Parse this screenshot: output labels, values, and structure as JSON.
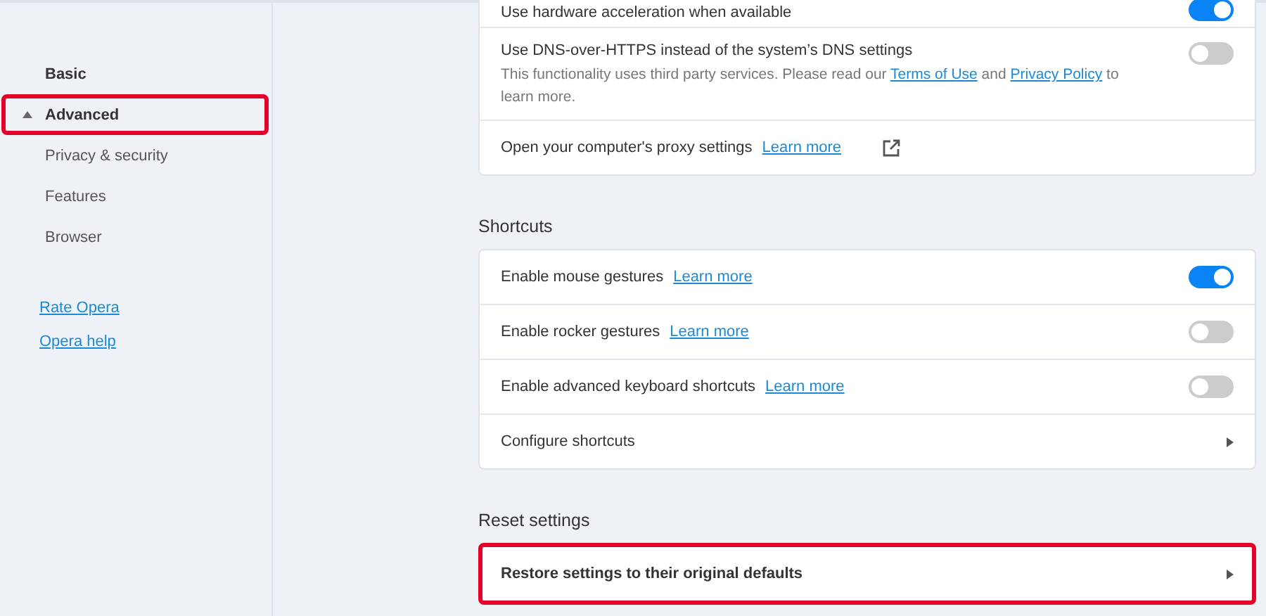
{
  "sidebar": {
    "items": [
      {
        "label": "Basic",
        "kind": "header",
        "expanded": false,
        "highlighted": false
      },
      {
        "label": "Advanced",
        "kind": "header",
        "expanded": true,
        "highlighted": true
      },
      {
        "label": "Privacy & security",
        "kind": "item",
        "highlighted": false
      },
      {
        "label": "Features",
        "kind": "item",
        "highlighted": false
      },
      {
        "label": "Browser",
        "kind": "item",
        "highlighted": false
      }
    ],
    "links": [
      "Rate Opera",
      "Opera help"
    ]
  },
  "sections": [
    {
      "rows": [
        {
          "kind": "toggle",
          "label": "Use hardware acceleration when available",
          "on": true
        },
        {
          "kind": "toggle",
          "label": "Use DNS-over-HTTPS instead of the system’s DNS settings",
          "description": [
            {
              "kind": "text",
              "text": "This functionality uses third party services. Please read our "
            },
            {
              "kind": "link",
              "text": "Terms of Use"
            },
            {
              "kind": "text",
              "text": " and "
            },
            {
              "kind": "link",
              "text": "Privacy Policy"
            },
            {
              "kind": "text",
              "text": " to learn more."
            }
          ],
          "on": false
        },
        {
          "kind": "external",
          "label": "Open your computer's proxy settings",
          "link": "Learn more"
        }
      ]
    },
    {
      "title": "Shortcuts",
      "rows": [
        {
          "kind": "toggle",
          "label": "Enable mouse gestures",
          "link": "Learn more",
          "on": true
        },
        {
          "kind": "toggle",
          "label": "Enable rocker gestures",
          "link": "Learn more",
          "on": false
        },
        {
          "kind": "toggle",
          "label": "Enable advanced keyboard shortcuts",
          "link": "Learn more",
          "on": false
        },
        {
          "kind": "nav",
          "label": "Configure shortcuts"
        }
      ]
    },
    {
      "title": "Reset settings",
      "rows": [
        {
          "kind": "action",
          "label": "Restore settings to their original defaults",
          "highlighted": true
        }
      ]
    }
  ]
}
